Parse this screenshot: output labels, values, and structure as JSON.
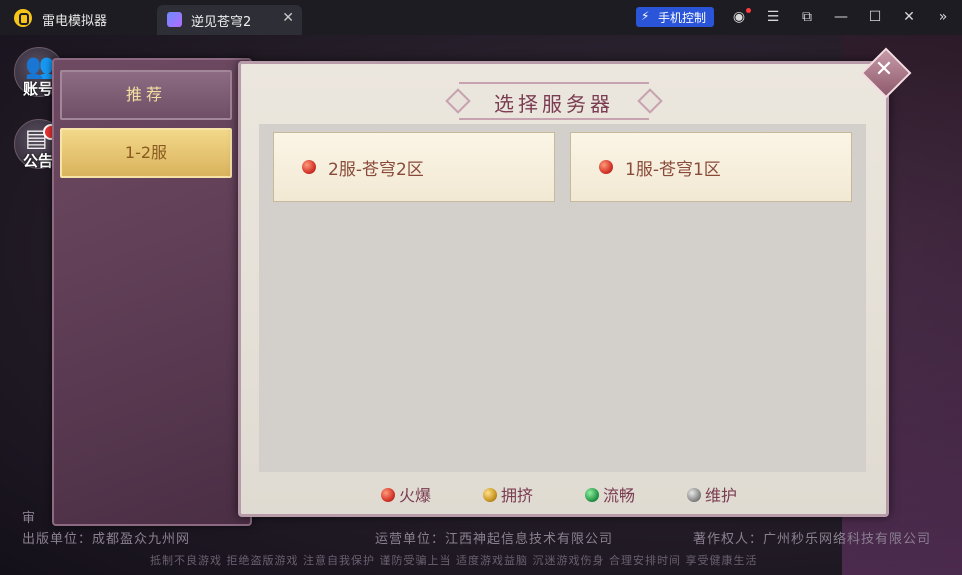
{
  "titlebar": {
    "app_name": "雷电模拟器",
    "tab_label": "逆见苍穹2",
    "tab_close": "✕",
    "phone_control": "手机控制",
    "icons": [
      "user-icon",
      "menu-icon",
      "popout-icon",
      "minimize-icon",
      "maximize-icon",
      "close-icon",
      "collapse-icon"
    ]
  },
  "game": {
    "side_buttons": [
      {
        "label": "账号",
        "icon": "account-icon"
      },
      {
        "label": "公告",
        "icon": "notice-icon"
      }
    ],
    "left_tabs": [
      {
        "label": "推荐"
      },
      {
        "label": "1-2服"
      }
    ],
    "dialog": {
      "title": "选择服务器",
      "servers": [
        {
          "name": "2服-苍穹2区",
          "status": "火爆"
        },
        {
          "name": "1服-苍穹1区",
          "status": "火爆"
        }
      ],
      "legend": [
        {
          "label": "火爆",
          "color": "red"
        },
        {
          "label": "拥挤",
          "color": "gold"
        },
        {
          "label": "流畅",
          "color": "green"
        },
        {
          "label": "维护",
          "color": "grey"
        }
      ]
    },
    "footer": {
      "examine": "审",
      "publisher": "出版单位：成都盈众九州网",
      "operator": "运营单位：江西神起信息技术有限公司",
      "copyright": "著作权人：广州秒乐网络科技有限公司",
      "notice": "抵制不良游戏 拒绝盗版游戏 注意自我保护 谨防受骗上当 适度游戏益脑 沉迷游戏伤身 合理安排时间 享受健康生活"
    }
  }
}
